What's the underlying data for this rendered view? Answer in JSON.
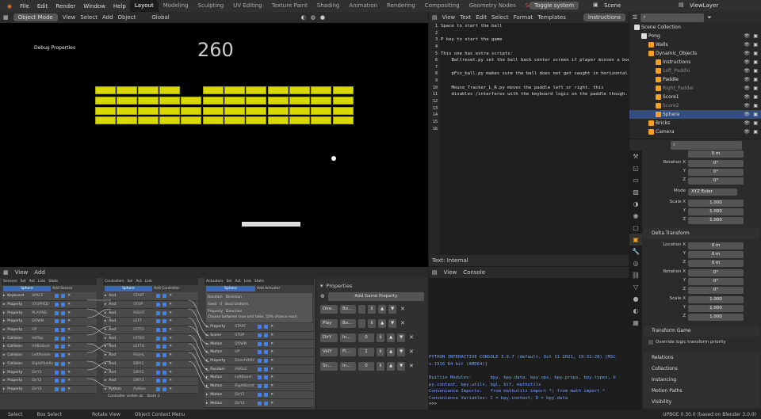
{
  "topmenu": {
    "items": [
      "File",
      "Edit",
      "Render",
      "Window",
      "Help"
    ],
    "workspaces": [
      "Layout",
      "Modeling",
      "Sculpting",
      "UV Editing",
      "Texture Paint",
      "Shading",
      "Animation",
      "Rendering",
      "Compositing",
      "Geometry Nodes",
      "Scripting"
    ],
    "toggle_system": "Toggle system",
    "scene": "Scene",
    "viewlayer": "ViewLayer"
  },
  "viewport_header": {
    "mode": "Object Mode",
    "view": "View",
    "select": "Select",
    "add": "Add",
    "object": "Object",
    "orientation": "Global"
  },
  "game": {
    "debug_label": "Debug Properties",
    "score": "260"
  },
  "text_editor": {
    "menu": [
      "View",
      "Text",
      "Edit",
      "Select",
      "Format",
      "Templates"
    ],
    "textname": "Instructions",
    "footer": "Text: Internal",
    "line_numbers": [
      "1",
      "2",
      "3",
      "4",
      "5",
      "6",
      "7",
      "8",
      "9",
      "10",
      "11",
      "12",
      "13",
      "14",
      "15",
      "16"
    ],
    "lines": [
      "Space to start the ball",
      "",
      "P key to start the game",
      "",
      "This one has extra scripts:",
      "    Ballreset.py set the ball back center screen if player misses a bounce",
      "",
      "    pFix_ball.py makes sure the ball does not get caught in horizontal loop",
      "",
      "    Mouse_Tracker_L_R.py moves the paddle left or right. this",
      "    disables /interferes with the keyboard logic on the paddle though.",
      "",
      "",
      "",
      "",
      ""
    ]
  },
  "console": {
    "menu": [
      "View",
      "Console"
    ],
    "lines": [
      "PYTHON INTERACTIVE CONSOLE 3.9.7 (default, Oct 11 2021, 19:31:28) [MSC",
      "v.1916 64 bit (AMD64)]",
      "",
      "Builtin Modules:       bpy, bpy.data, bpy.ops, bpy.props, bpy.types, b",
      "py.context, bpy.utils, bgl, blf, mathutils",
      "Convenience Imports:   from mathutils import *; from math import *",
      "Convenience Variables: C = bpy.context, D = bpy.data"
    ],
    "prompt": ">>>"
  },
  "logic_editor": {
    "menu": [
      "View",
      "Add"
    ],
    "sensors": {
      "title": "Sensors",
      "obj": "Sphere",
      "add": "Add Sensor",
      "filters": [
        "Sel",
        "Act",
        "Link",
        "State"
      ],
      "rows": [
        [
          "Keyboard",
          "SPACE"
        ],
        [
          "Property",
          "STOPPED"
        ],
        [
          "Property",
          "PLAYING"
        ],
        [
          "Property",
          "DOWN"
        ],
        [
          "Property",
          "UP"
        ],
        [
          "Collision",
          "HitTop"
        ],
        [
          "Collision",
          "HitBottom"
        ],
        [
          "Collision",
          "LeftPaddle"
        ],
        [
          "Collision",
          "RightPaddle"
        ],
        [
          "Property",
          "DirY1"
        ],
        [
          "Property",
          "DirY2"
        ],
        [
          "Property",
          "DirY3"
        ]
      ]
    },
    "controllers": {
      "title": "Controllers",
      "obj": "Sphere",
      "add": "Add Controller",
      "filters": [
        "Sel",
        "Act",
        "Link"
      ],
      "rows": [
        [
          "And",
          "START"
        ],
        [
          "And",
          "STOP"
        ],
        [
          "And",
          "RIGHT"
        ],
        [
          "And",
          "LEFT"
        ],
        [
          "And",
          "HITTO"
        ],
        [
          "And",
          "HITBO"
        ],
        [
          "And",
          "LEFTO"
        ],
        [
          "And",
          "RIGHL"
        ],
        [
          "And",
          "DIRY1"
        ],
        [
          "And",
          "DIRY2"
        ],
        [
          "And",
          "DIRY3"
        ],
        [
          "Python",
          "Python"
        ]
      ],
      "footer": "Controller visible at:",
      "footer2": "State 1"
    },
    "actuators": {
      "title": "Actuators",
      "obj": "Sphere",
      "add": "Add Actuator",
      "filters": [
        "Sel",
        "Act",
        "Link",
        "State"
      ],
      "random_name": "Random",
      "random_type": "Direction",
      "seed": "Seed",
      "seed_val": "0",
      "distribution": "Bool Uniform",
      "property": "Property",
      "prop_val": "Direction",
      "hint": "Choose between true and false, 50% chance each",
      "rows": [
        [
          "Property",
          "START"
        ],
        [
          "Scene",
          "STOP"
        ],
        [
          "Motion",
          "DOWN"
        ],
        [
          "Motion",
          "UP"
        ],
        [
          "Property",
          "DirectVARY"
        ],
        [
          "Random",
          "ANGLE"
        ],
        [
          "Motion",
          "LeftBoost"
        ],
        [
          "Motion",
          "RightBoost"
        ],
        [
          "Motion",
          "DirY1"
        ],
        [
          "Motion",
          "DirY2"
        ]
      ]
    }
  },
  "game_properties": {
    "title": "Properties",
    "add": "Add Game Property",
    "rows": [
      {
        "name": "Dire..",
        "type": "Bo..."
      },
      {
        "name": "Play",
        "type": "Bo..."
      },
      {
        "name": "DirY",
        "type": "In...",
        "val": "0"
      },
      {
        "name": "VelY",
        "type": "Fl...",
        "val": "1"
      },
      {
        "name": "Sc...",
        "type": "In...",
        "val": "0"
      }
    ]
  },
  "outliner": {
    "rows": [
      {
        "label": "Scene Collection",
        "depth": 0
      },
      {
        "label": "Pong",
        "depth": 1
      },
      {
        "label": "Walls",
        "depth": 2
      },
      {
        "label": "Dynamic_Objects",
        "depth": 2
      },
      {
        "label": "Instructions",
        "depth": 3
      },
      {
        "label": "Left_Paddle",
        "depth": 3
      },
      {
        "label": "Paddle",
        "depth": 3
      },
      {
        "label": "Right_Paddel",
        "depth": 3
      },
      {
        "label": "Score1",
        "depth": 3
      },
      {
        "label": "Score2",
        "depth": 3
      },
      {
        "label": "Sphere",
        "depth": 3
      },
      {
        "label": "Bricks",
        "depth": 2
      },
      {
        "label": "Camera",
        "depth": 2
      }
    ]
  },
  "props_editor": {
    "top_field": "0 m",
    "rotation": {
      "label": "Rotation X",
      "x": "0°",
      "y": "0°",
      "z": "0°"
    },
    "mode": {
      "label": "Mode",
      "value": "XYZ Euler"
    },
    "scale": {
      "label": "Scale X",
      "x": "1.000",
      "y": "1.000",
      "z": "1.000"
    },
    "delta_title": "Delta Transform",
    "dloc": {
      "label": "Location X",
      "x": "0 m",
      "y": "0 m",
      "z": "0 m"
    },
    "drot": {
      "label": "Rotation X",
      "x": "0°",
      "y": "0°",
      "z": "0°"
    },
    "dscale": {
      "label": "Scale X",
      "x": "1.000",
      "y": "1.000",
      "z": "1.000"
    },
    "axis_y": "Y",
    "axis_z": "Z",
    "transform_game": "Transform Game",
    "override": "Override logic transform priority",
    "sections": [
      "Relations",
      "Collections",
      "Instancing",
      "Motion Paths",
      "Visibility"
    ]
  },
  "statusbar": {
    "items": [
      "Select",
      "Box Select",
      "Rotate View",
      "Object Context Menu"
    ],
    "version": "UPBGE 0.30.0 (based on Blender 3.0.0)"
  }
}
